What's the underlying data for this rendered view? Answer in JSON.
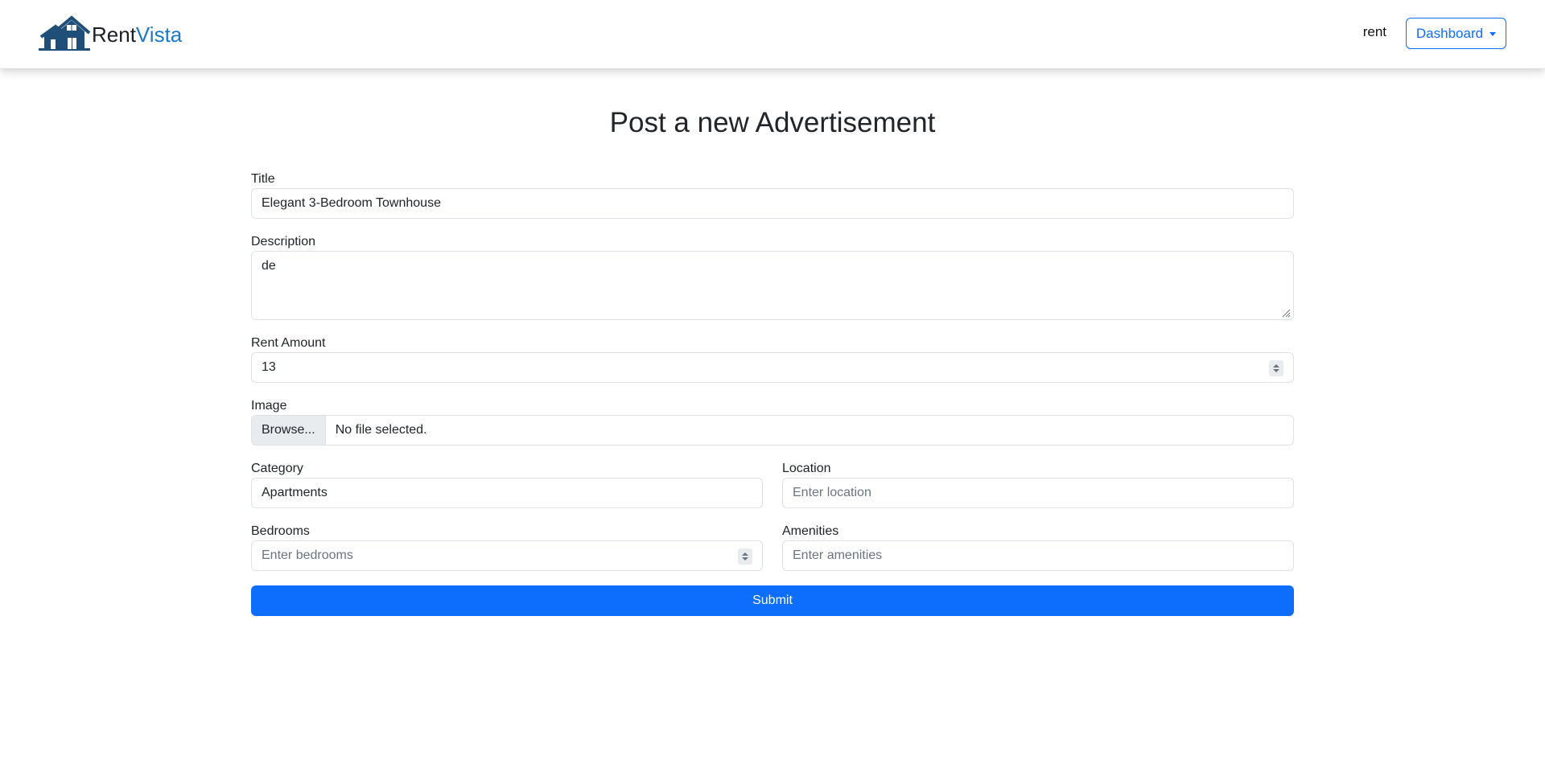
{
  "brand": {
    "name_part1": "Rent",
    "name_part2": "Vista",
    "logo_icon": "house-logo-icon"
  },
  "nav": {
    "user_label": "rent",
    "dropdown_label": "Dashboard"
  },
  "page": {
    "title": "Post a new Advertisement"
  },
  "form": {
    "title": {
      "label": "Title",
      "value": "Elegant 3-Bedroom Townhouse"
    },
    "description": {
      "label": "Description",
      "value": "de"
    },
    "rent_amount": {
      "label": "Rent Amount",
      "value": "13"
    },
    "image": {
      "label": "Image",
      "browse_label": "Browse...",
      "file_status": "No file selected."
    },
    "category": {
      "label": "Category",
      "value": "Apartments"
    },
    "location": {
      "label": "Location",
      "placeholder": "Enter location"
    },
    "bedrooms": {
      "label": "Bedrooms",
      "placeholder": "Enter bedrooms"
    },
    "amenities": {
      "label": "Amenities",
      "placeholder": "Enter amenities"
    },
    "submit_label": "Submit"
  },
  "colors": {
    "primary": "#0d6efd",
    "brand_accent": "#1e78c8",
    "logo_dark": "#1f4e79"
  }
}
